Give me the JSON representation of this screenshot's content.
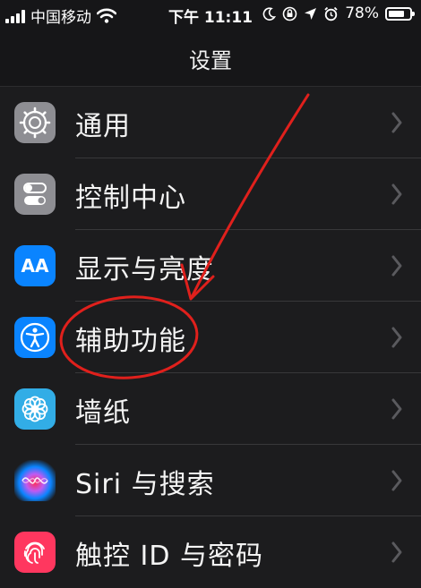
{
  "status_bar": {
    "carrier": "中国移动",
    "time": "下午 11:11",
    "battery": "78%",
    "battery_level": 0.78
  },
  "nav": {
    "title": "设置"
  },
  "settings": [
    {
      "label": "通用",
      "icon": "gear-icon"
    },
    {
      "label": "控制中心",
      "icon": "toggle-icon"
    },
    {
      "label": "显示与亮度",
      "icon": "text-size-icon",
      "icon_text": "AA"
    },
    {
      "label": "辅助功能",
      "icon": "accessibility-icon"
    },
    {
      "label": "墙纸",
      "icon": "flower-icon"
    },
    {
      "label": "Siri 与搜索",
      "icon": "siri-icon"
    },
    {
      "label": "触控 ID 与密码",
      "icon": "fingerprint-icon"
    }
  ],
  "colors": {
    "annotation": "#e0201c",
    "accent": "#0a84ff",
    "gray_icon": "#8e8e93"
  }
}
